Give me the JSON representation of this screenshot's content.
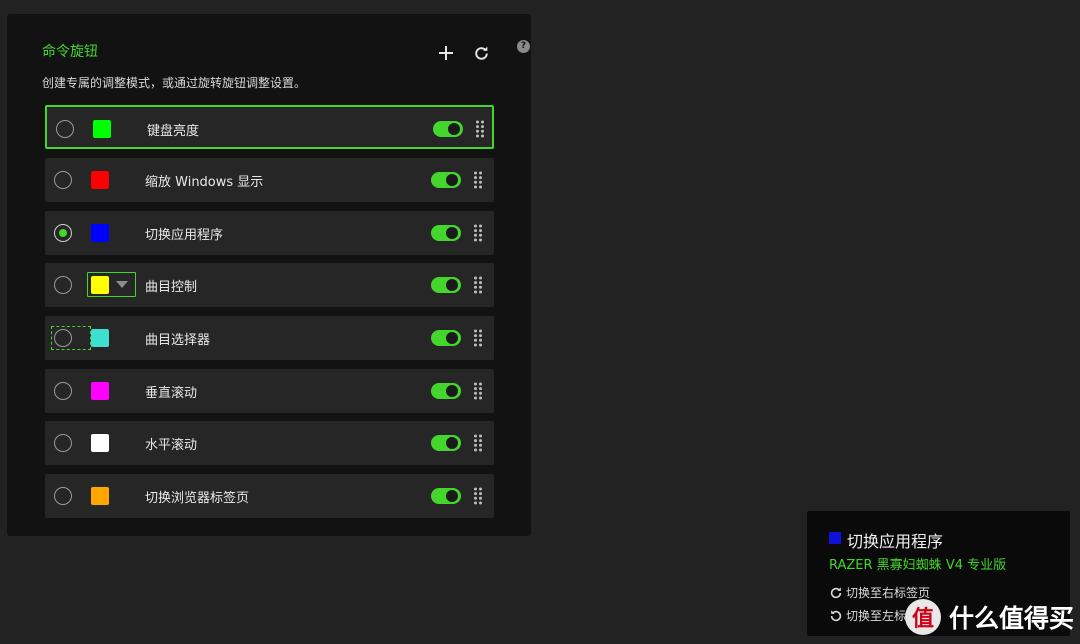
{
  "panel": {
    "title": "命令旋钮",
    "description": "创建专属的调整模式，或通过旋转旋钮调整设置。",
    "help_icon": "?",
    "icons": {
      "add": "plus-icon",
      "refresh": "refresh-icon",
      "drag": "drag-handle-icon"
    }
  },
  "commands": [
    {
      "label": "键盘亮度",
      "color": "#00ff00",
      "enabled": true
    },
    {
      "label": "缩放 Windows 显示",
      "color": "#ff0000",
      "enabled": true
    },
    {
      "label": "切换应用程序",
      "color": "#0000ff",
      "enabled": true
    },
    {
      "label": "曲目控制",
      "color": "#ffff00",
      "enabled": true
    },
    {
      "label": "曲目选择器",
      "color": "#40e0d0",
      "enabled": true
    },
    {
      "label": "垂直滚动",
      "color": "#ff00ff",
      "enabled": true
    },
    {
      "label": "水平滚动",
      "color": "#ffffff",
      "enabled": true
    },
    {
      "label": "切换浏览器标签页",
      "color": "#ffa500",
      "enabled": true
    }
  ],
  "active_command": "切换应用程序",
  "toast": {
    "title": "切换应用程序",
    "device": "RAZER 黑寡妇蜘蛛 V4 专业版",
    "items": [
      {
        "label": "切换至右标签页",
        "icon": "rotate-cw-icon"
      },
      {
        "label": "切换至左标签页",
        "icon": "rotate-ccw-icon"
      }
    ]
  },
  "watermark": {
    "logo": "值",
    "text": "什么值得买"
  },
  "colors": {
    "accent": "#44d62c",
    "background": "#222222",
    "panel": "#121212",
    "row": "#262626"
  }
}
